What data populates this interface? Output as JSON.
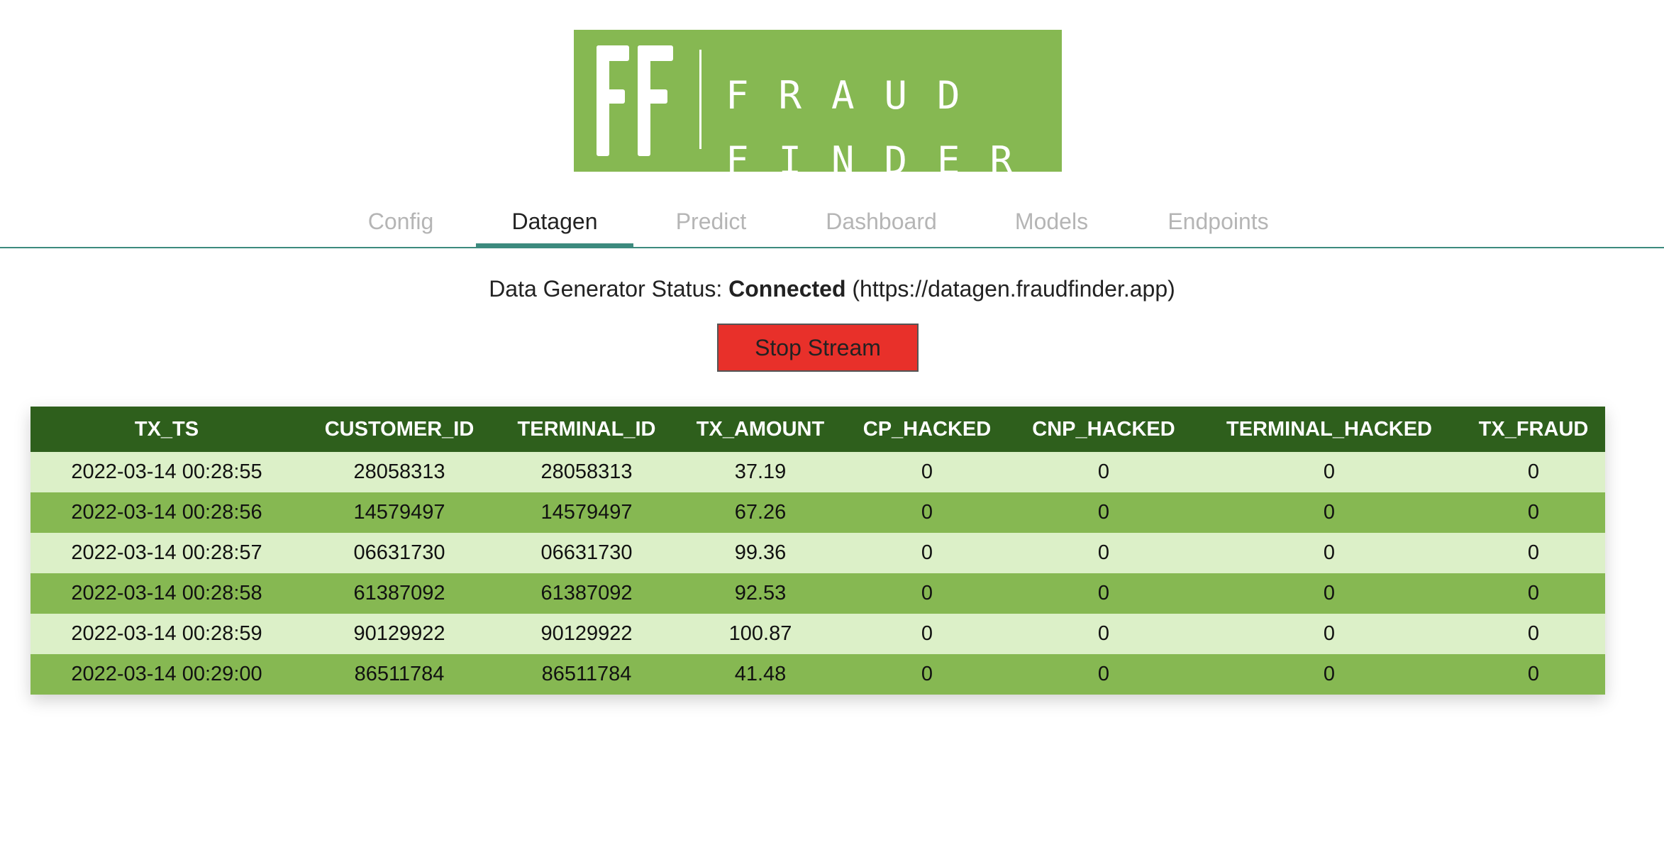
{
  "logo": {
    "monogram": "FF",
    "line1": "FRAUD",
    "line2": "FINDER",
    "bg_color": "#86b852"
  },
  "tabs": [
    {
      "label": "Config",
      "active": false
    },
    {
      "label": "Datagen",
      "active": true
    },
    {
      "label": "Predict",
      "active": false
    },
    {
      "label": "Dashboard",
      "active": false
    },
    {
      "label": "Models",
      "active": false
    },
    {
      "label": "Endpoints",
      "active": false
    }
  ],
  "status": {
    "prefix": "Data Generator Status:",
    "state": "Connected",
    "url": "(https://datagen.fraudfinder.app)"
  },
  "stream_button": {
    "label": "Stop Stream",
    "color": "#e8302a"
  },
  "table": {
    "columns": [
      "TX_TS",
      "CUSTOMER_ID",
      "TERMINAL_ID",
      "TX_AMOUNT",
      "CP_HACKED",
      "CNP_HACKED",
      "TERMINAL_HACKED",
      "TX_FRAUD"
    ],
    "rows": [
      [
        "2022-03-14 00:28:55",
        "28058313",
        "28058313",
        "37.19",
        "0",
        "0",
        "0",
        "0"
      ],
      [
        "2022-03-14 00:28:56",
        "14579497",
        "14579497",
        "67.26",
        "0",
        "0",
        "0",
        "0"
      ],
      [
        "2022-03-14 00:28:57",
        "06631730",
        "06631730",
        "99.36",
        "0",
        "0",
        "0",
        "0"
      ],
      [
        "2022-03-14 00:28:58",
        "61387092",
        "61387092",
        "92.53",
        "0",
        "0",
        "0",
        "0"
      ],
      [
        "2022-03-14 00:28:59",
        "90129922",
        "90129922",
        "100.87",
        "0",
        "0",
        "0",
        "0"
      ],
      [
        "2022-03-14 00:29:00",
        "86511784",
        "86511784",
        "41.48",
        "0",
        "0",
        "0",
        "0"
      ]
    ],
    "header_color": "#2e5f1c",
    "row_light_color": "#dcf0c8",
    "row_dark_color": "#86b852"
  },
  "accent_color": "#3c8a7e"
}
